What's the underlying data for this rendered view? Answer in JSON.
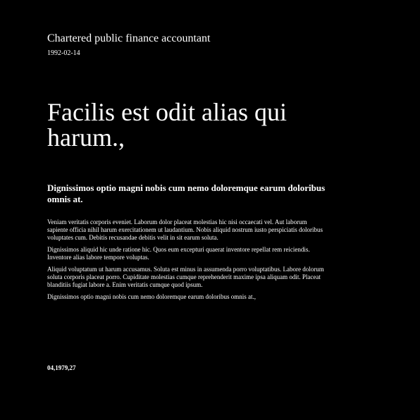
{
  "document": {
    "subtitle": "Chartered public finance accountant",
    "date": "1992-02-14",
    "headline": "Facilis est odit alias qui harum.,",
    "lead": "Dignissimos optio magni nobis cum nemo doloremque earum doloribus omnis at.",
    "paragraphs": [
      "Veniam veritatis corporis eveniet. Laborum dolor placeat molestias hic nisi occaecati vel. Aut laborum sapiente officia nihil harum exercitationem ut laudantium. Nobis aliquid nostrum iusto perspiciatis doloribus voluptates cum. Debitis recusandae debitis velit in sit earum soluta.",
      "Dignissimos aliquid hic unde ratione hic. Quos eum excepturi quaerat inventore repellat rem reiciendis. Inventore alias labore tempore voluptas.",
      "Aliquid voluptatum ut harum accusamus. Soluta est minus in assumenda porro voluptatibus. Labore dolorum soluta corporis placeat porro. Cupiditate molestias cumque reprehenderit maxime ipsa aliquam odit. Placeat blanditiis fugiat labore a. Enim veritatis cumque quod ipsum.",
      "Dignissimos optio magni nobis cum nemo doloremque earum doloribus omnis at.,"
    ],
    "footer": "04,1979,27"
  }
}
